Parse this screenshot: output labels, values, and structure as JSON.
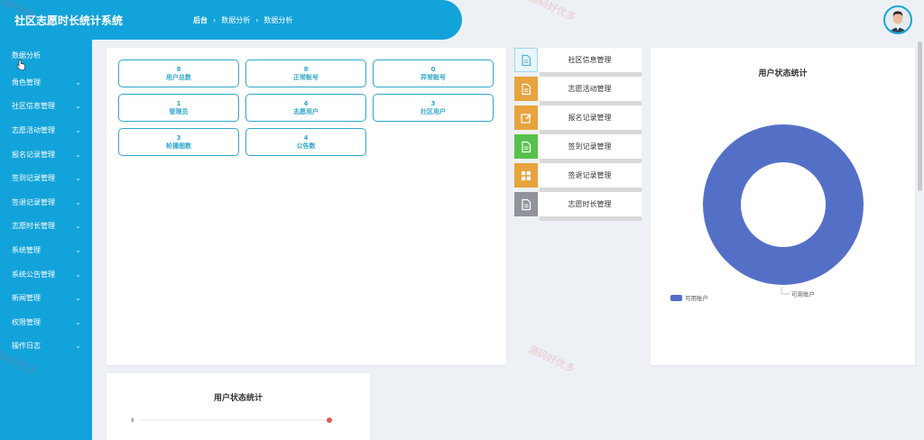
{
  "header": {
    "title": "社区志愿时长统计系统",
    "breadcrumb": [
      "后台",
      "数据分析",
      "数据分析"
    ]
  },
  "sidebar": {
    "items": [
      {
        "label": "数据分析",
        "chevron": false
      },
      {
        "label": "角色管理",
        "chevron": true
      },
      {
        "label": "社区信息管理",
        "chevron": true
      },
      {
        "label": "志愿活动管理",
        "chevron": true
      },
      {
        "label": "报名记录管理",
        "chevron": true
      },
      {
        "label": "签到记录管理",
        "chevron": true
      },
      {
        "label": "签退记录管理",
        "chevron": true
      },
      {
        "label": "志愿时长管理",
        "chevron": true
      },
      {
        "label": "系统管理",
        "chevron": true
      },
      {
        "label": "系统公告管理",
        "chevron": true
      },
      {
        "label": "新闻管理",
        "chevron": true
      },
      {
        "label": "权限管理",
        "chevron": true
      },
      {
        "label": "操作日志",
        "chevron": true
      }
    ]
  },
  "stats": [
    {
      "value": "8",
      "label": "用户总数"
    },
    {
      "value": "8",
      "label": "正常账号"
    },
    {
      "value": "0",
      "label": "异常账号"
    },
    {
      "value": "1",
      "label": "管理员"
    },
    {
      "value": "4",
      "label": "志愿用户"
    },
    {
      "value": "3",
      "label": "社区用户"
    },
    {
      "value": "3",
      "label": "轮播图数"
    },
    {
      "value": "4",
      "label": "公告数"
    }
  ],
  "menu": [
    {
      "label": "社区信息管理",
      "icon": "document-icon",
      "color": "#e9f6fb"
    },
    {
      "label": "志愿活动管理",
      "icon": "document-icon",
      "color": "#e7a33e"
    },
    {
      "label": "报名记录管理",
      "icon": "edit-icon",
      "color": "#e7a33e"
    },
    {
      "label": "签到记录管理",
      "icon": "document-icon",
      "color": "#58c04c"
    },
    {
      "label": "签退记录管理",
      "icon": "grid-icon",
      "color": "#e7a33e"
    },
    {
      "label": "志愿时长管理",
      "icon": "document-icon",
      "color": "#909399"
    }
  ],
  "chart_data": [
    {
      "type": "pie",
      "title": "用户状态统计",
      "categories": [
        "可用账户"
      ],
      "values": [
        8
      ],
      "colors": [
        "#5470c6"
      ],
      "legend": "bottom-left",
      "donut": true
    },
    {
      "type": "line",
      "title": "用户状态统计",
      "ytick": "8",
      "values": [
        8
      ],
      "colors": [
        "#e05a57"
      ]
    }
  ],
  "watermark_text": "源码好优多"
}
